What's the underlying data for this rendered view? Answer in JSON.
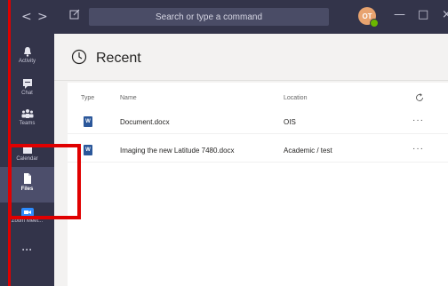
{
  "titlebar": {
    "back": "<",
    "forward": ">",
    "search_placeholder": "Search or type a command",
    "avatar_initials": "OT",
    "minimize": "—",
    "maximize": "□",
    "close": "×"
  },
  "rail": {
    "items": [
      {
        "label": "Activity",
        "icon": "bell-icon"
      },
      {
        "label": "Chat",
        "icon": "chat-icon"
      },
      {
        "label": "Teams",
        "icon": "teams-icon"
      },
      {
        "label": "Calendar",
        "icon": "calendar-icon"
      },
      {
        "label": "Files",
        "icon": "files-icon",
        "active": true
      },
      {
        "label": "Zoom Meet...",
        "icon": "zoom-icon"
      },
      {
        "label": "···",
        "icon": "more-apps-icon"
      }
    ]
  },
  "main": {
    "title": "Recent",
    "columns": {
      "type": "Type",
      "name": "Name",
      "location": "Location"
    },
    "rows": [
      {
        "type_icon": "W",
        "name": "Document.docx",
        "location": "OIS",
        "more": "···"
      },
      {
        "type_icon": "W",
        "name": "Imaging the new Latitude 7480.docx",
        "location": "Academic / test",
        "more": "···"
      }
    ]
  },
  "colors": {
    "rail": "#33344a",
    "accent_word": "#2b579a",
    "highlight": "#e00000"
  }
}
